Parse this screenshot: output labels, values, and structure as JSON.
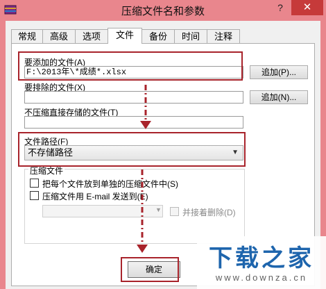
{
  "window": {
    "title": "压缩文件名和参数",
    "help_label": "?",
    "close_label": "✕",
    "icon": "winrar-app-icon"
  },
  "tabs": [
    {
      "label": "常规"
    },
    {
      "label": "高级"
    },
    {
      "label": "选项"
    },
    {
      "label": "文件"
    },
    {
      "label": "备份"
    },
    {
      "label": "时间"
    },
    {
      "label": "注释"
    }
  ],
  "active_tab": "文件",
  "files_to_add": {
    "label": "要添加的文件(A)",
    "value": "F:\\2013年\\*成绩*.xlsx",
    "button": "追加(P)..."
  },
  "files_to_exclude": {
    "label": "要排除的文件(X)",
    "value": "",
    "button": "追加(N)..."
  },
  "files_no_compress": {
    "label": "不压缩直接存储的文件(T)",
    "value": ""
  },
  "file_paths": {
    "label": "文件路径(F)",
    "selected": "不存储路径"
  },
  "archive_group": {
    "title": "压缩文件",
    "option_separate": "把每个文件放到单独的压缩文件中(S)",
    "option_email": "压缩文件用 E-mail 发送到(E)",
    "option_delete": "并接着删除(D)"
  },
  "footer": {
    "ok_label": "确定"
  },
  "watermark": {
    "title": "下载之家",
    "url": "www.downza.cn"
  },
  "colors": {
    "window_frame": "#e9868d",
    "close_button": "#c63a3a",
    "highlight": "#a8232b",
    "arrow": "#a8232b",
    "watermark": "#0e5aa7"
  }
}
